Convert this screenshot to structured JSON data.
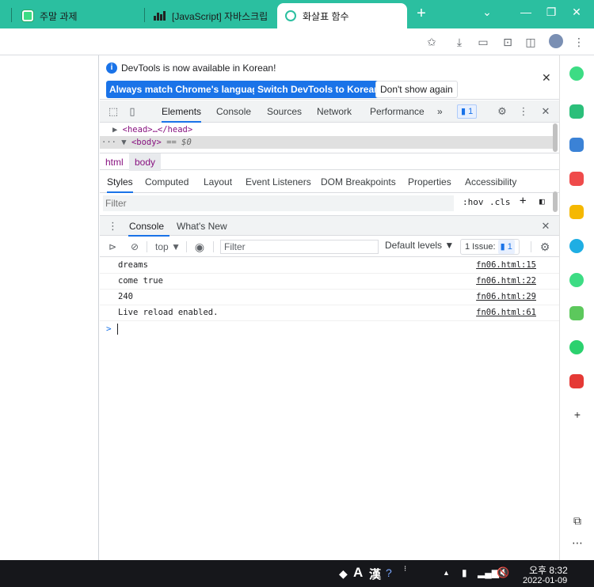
{
  "browser": {
    "tabs": [
      {
        "title": "주말 과제",
        "icon": "green-app-icon",
        "active": false
      },
      {
        "title": "[JavaScript] 자바스크립",
        "icon": "bar-chart-icon",
        "active": false
      },
      {
        "title": "화살표 함수",
        "icon": "ring-icon",
        "active": true
      }
    ],
    "new_tab_label": "+",
    "window_controls": [
      "⌄",
      "—",
      "❐",
      "✕"
    ]
  },
  "devtools": {
    "infobar": {
      "message": "DevTools is now available in Korean!",
      "match_btn": "Always match Chrome's language",
      "switch_btn": "Switch DevTools to Korean",
      "dismiss_btn": "Don't show again"
    },
    "main_tabs": [
      "Elements",
      "Console",
      "Sources",
      "Network",
      "Performance"
    ],
    "main_more": "»",
    "issues_count": "1",
    "dom": {
      "line1": "<head>…</head>",
      "line2_tag": "<body>",
      "line2_eq": " == $0"
    },
    "breadcrumbs": [
      "html",
      "body"
    ],
    "style_tabs": [
      "Styles",
      "Computed",
      "Layout",
      "Event Listeners",
      "DOM Breakpoints",
      "Properties",
      "Accessibility"
    ],
    "styles_filter_placeholder": "Filter",
    "hov": ":hov",
    "cls": ".cls",
    "drawer_tabs": [
      "Console",
      "What's New"
    ],
    "console_toolbar": {
      "context": "top ▼",
      "filter_placeholder": "Filter",
      "levels": "Default levels ▼",
      "issue_label": "1 Issue:",
      "issue_count": "1"
    },
    "console_rows": [
      {
        "message": "dreams",
        "source": "fn06.html:15"
      },
      {
        "message": "come true",
        "source": "fn06.html:22"
      },
      {
        "message": "240",
        "source": "fn06.html:29"
      },
      {
        "message": "Live reload enabled.",
        "source": "fn06.html:61"
      }
    ],
    "prompt": ">"
  },
  "taskbar": {
    "ime_a": "A",
    "ime_han": "漢",
    "time": "오후 8:32",
    "date": "2022-01-09"
  },
  "colors": {
    "tabstrip": "#2bbfa0",
    "accent": "#1a73e8",
    "taskbar": "#16171b"
  }
}
